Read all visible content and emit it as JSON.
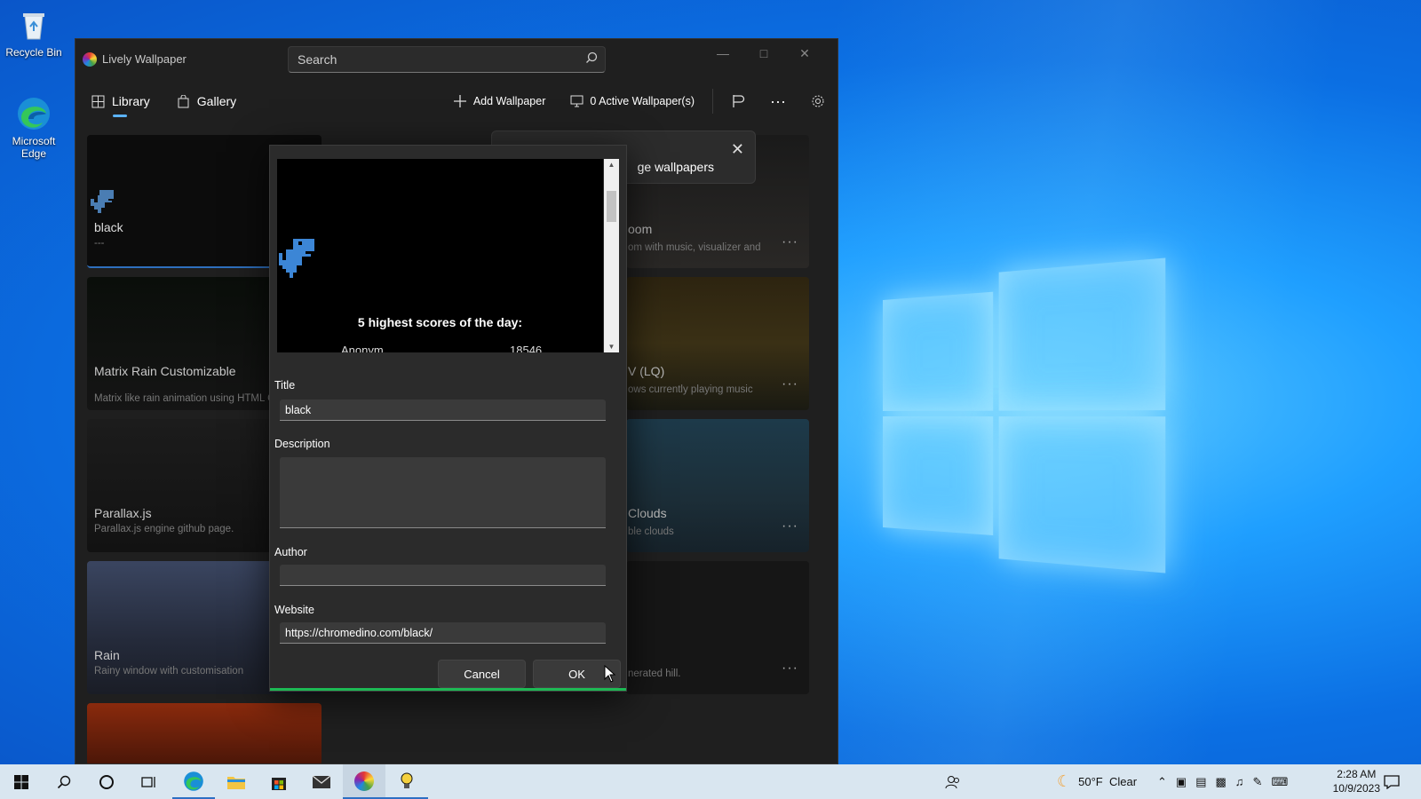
{
  "desktop": {
    "icons": [
      {
        "label": "Recycle Bin",
        "icon": "recycle-bin-icon"
      },
      {
        "label": "Microsoft Edge",
        "icon": "edge-icon"
      }
    ]
  },
  "window": {
    "title": "Lively Wallpaper",
    "search_placeholder": "Search",
    "nav": {
      "library": "Library",
      "gallery": "Gallery",
      "add_wallpaper": "Add Wallpaper",
      "active_wallpapers": "0 Active Wallpaper(s)"
    }
  },
  "cards_left": [
    {
      "title": "black",
      "desc": "---"
    },
    {
      "title": "Matrix Rain Customizable",
      "desc": "Matrix like rain animation using HTML Canvas."
    },
    {
      "title": "Parallax.js",
      "desc": "Parallax.js engine github page."
    },
    {
      "title": "Rain",
      "desc": "Rainy window with customisation"
    }
  ],
  "cards_right": [
    {
      "title": "oom",
      "desc": "om with music, visualizer and"
    },
    {
      "title": "V (LQ)",
      "desc": "ows currently playing music"
    },
    {
      "title": "Clouds",
      "desc": "ble clouds"
    },
    {
      "title": "",
      "desc": "nerated hill."
    }
  ],
  "tip": {
    "text": "ge wallpapers"
  },
  "dialog": {
    "preview": {
      "scores_title": "5 highest scores of the day:",
      "first_name": "Anonym",
      "first_score": "18546"
    },
    "title_label": "Title",
    "title_value": "black",
    "description_label": "Description",
    "description_value": "",
    "author_label": "Author",
    "author_value": "",
    "website_label": "Website",
    "website_value": "https://chromedino.com/black/",
    "cancel": "Cancel",
    "ok": "OK"
  },
  "taskbar": {
    "weather": "50°F  Clear",
    "time": "2:28 AM",
    "date": "10/9/2023"
  },
  "colors": {
    "accent": "#5bb3ff",
    "progress": "#1db954",
    "window_bg": "#1f1f1f",
    "dialog_bg": "#2b2b2b"
  }
}
